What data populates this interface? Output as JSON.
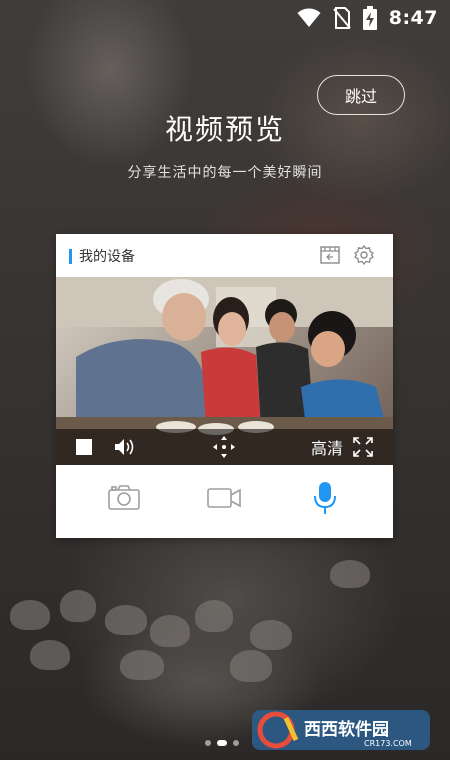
{
  "status_bar": {
    "time": "8:47"
  },
  "skip_label": "跳过",
  "title": "视频预览",
  "subtitle": "分享生活中的每一个美好瞬间",
  "card": {
    "label": "我的设备",
    "video_controls": {
      "hd_label": "高清"
    },
    "icons": [
      "film-settings-icon",
      "gear-icon",
      "stop-icon",
      "speaker-icon",
      "move-arrows-icon",
      "fullscreen-icon",
      "camera-icon",
      "video-camera-icon",
      "microphone-icon"
    ]
  },
  "pager": {
    "count": 3,
    "active": 2
  },
  "watermark": {
    "brand": "西西软件园",
    "domain": "CR173.COM"
  },
  "colors": {
    "accent": "#2196f3",
    "card_bg": "#ffffff",
    "icon_gray": "#9e9e9e"
  }
}
